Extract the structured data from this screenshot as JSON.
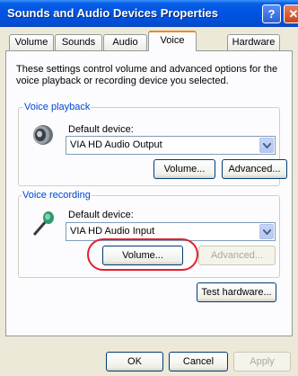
{
  "window": {
    "title": "Sounds and Audio Devices Properties",
    "help_label": "?",
    "close_label": "✕"
  },
  "tabs": [
    {
      "label": "Volume"
    },
    {
      "label": "Sounds"
    },
    {
      "label": "Audio"
    },
    {
      "label": "Voice",
      "active": true
    },
    {
      "label": "Hardware"
    }
  ],
  "panel": {
    "description": "These settings control volume and advanced options for the voice playback or recording device you selected."
  },
  "playback": {
    "group_label": "Voice playback",
    "device_label": "Default device:",
    "device_value": "VIA HD Audio Output",
    "volume_button": "Volume...",
    "advanced_button": "Advanced..."
  },
  "recording": {
    "group_label": "Voice recording",
    "device_label": "Default device:",
    "device_value": "VIA HD Audio Input",
    "volume_button": "Volume...",
    "advanced_button": "Advanced...",
    "advanced_enabled": false
  },
  "test_hardware_button": "Test hardware...",
  "footer": {
    "ok": "OK",
    "cancel": "Cancel",
    "apply": "Apply"
  },
  "colors": {
    "title_blue": "#0054e3",
    "group_label_blue": "#0046d5",
    "highlight_red": "#e2202e"
  },
  "icons": {
    "playback": "speaker-icon",
    "recording": "microphone-icon"
  }
}
